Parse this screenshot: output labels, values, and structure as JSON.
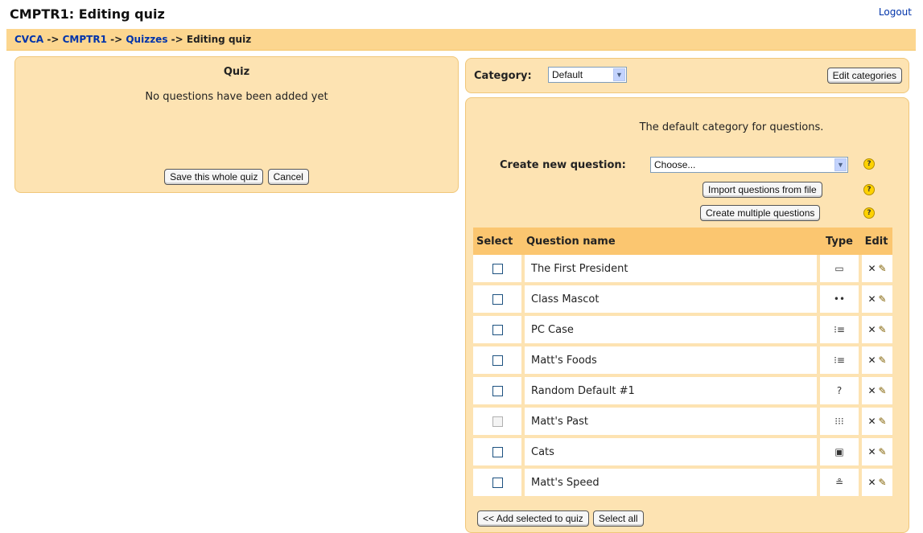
{
  "header": {
    "title": "CMPTR1: Editing quiz",
    "logout_label": "Logout"
  },
  "breadcrumb": {
    "items": [
      "CVCA",
      "CMPTR1",
      "Quizzes"
    ],
    "separator": "->",
    "current": "Editing quiz"
  },
  "quiz_panel": {
    "title": "Quiz",
    "empty_message": "No questions have been added yet",
    "save_label": "Save this whole quiz",
    "cancel_label": "Cancel"
  },
  "category_panel": {
    "label": "Category:",
    "selected": "Default",
    "edit_label": "Edit categories"
  },
  "questions_panel": {
    "description": "The default category for questions.",
    "create_label": "Create new question:",
    "create_selected": "Choose...",
    "import_label": "Import questions from file",
    "multiple_label": "Create multiple questions",
    "help_icon": "question-mark-icon",
    "headers": {
      "select": "Select",
      "name": "Question name",
      "type": "Type",
      "edit": "Edit"
    },
    "rows": [
      {
        "name": "The First President",
        "type_icon": "short-answer-icon",
        "type_glyph": "▭",
        "enabled": true
      },
      {
        "name": "Class Mascot",
        "type_icon": "true-false-icon",
        "type_glyph": "••",
        "enabled": true
      },
      {
        "name": "PC Case",
        "type_icon": "multiple-choice-icon",
        "type_glyph": "⁝≡",
        "enabled": true
      },
      {
        "name": "Matt's Foods",
        "type_icon": "multiple-choice-icon",
        "type_glyph": "⁝≡",
        "enabled": true
      },
      {
        "name": "Random Default #1",
        "type_icon": "random-icon",
        "type_glyph": "?",
        "enabled": true
      },
      {
        "name": "Matt's Past",
        "type_icon": "matching-icon",
        "type_glyph": "⁝⁝⁝",
        "enabled": false
      },
      {
        "name": "Cats",
        "type_icon": "description-icon",
        "type_glyph": "▣",
        "enabled": true
      },
      {
        "name": "Matt's Speed",
        "type_icon": "numerical-icon",
        "type_glyph": "≗",
        "enabled": true
      }
    ],
    "edit_delete_glyph": "✕",
    "edit_edit_glyph": "✎",
    "add_selected_label": "<< Add selected to quiz",
    "select_all_label": "Select all"
  },
  "colors": {
    "panel_bg": "#fde3b2",
    "header_bg": "#fbc670",
    "link": "#0033aa"
  }
}
